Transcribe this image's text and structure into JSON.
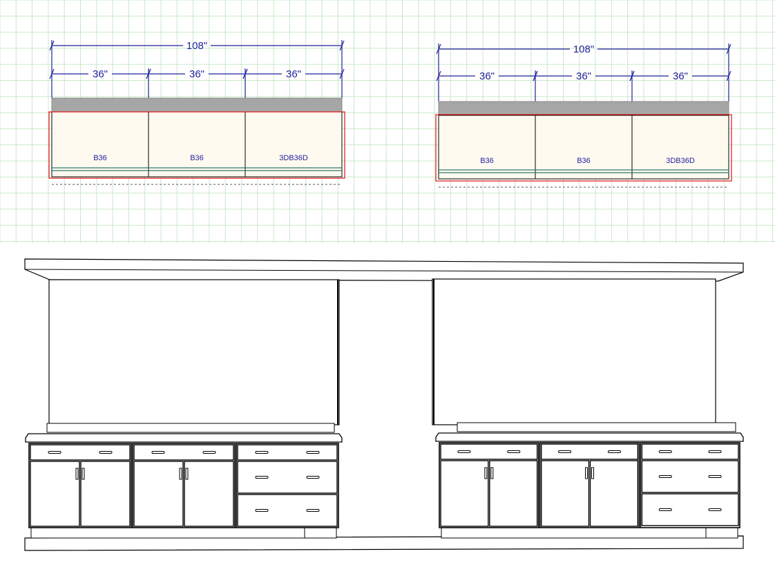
{
  "colors": {
    "grid": "#c9e8c9",
    "dimension": "#1f1f9c",
    "cabinet_fill": "#fffaf0",
    "countertop": "#a6a6a6",
    "outline_red": "#e01010",
    "toe_kick": "#2a7a6a",
    "line": "#000000"
  },
  "plan": {
    "runs": [
      {
        "overall_label": "108\"",
        "segment_labels": [
          "36\"",
          "36\"",
          "36\""
        ],
        "cabinets": [
          {
            "label": "B36",
            "type": "base"
          },
          {
            "label": "B36",
            "type": "base"
          },
          {
            "label": "3DB36D",
            "type": "drawer-base"
          }
        ]
      },
      {
        "overall_label": "108\"",
        "segment_labels": [
          "36\"",
          "36\"",
          "36\""
        ],
        "cabinets": [
          {
            "label": "B36",
            "type": "base"
          },
          {
            "label": "B36",
            "type": "base"
          },
          {
            "label": "3DB36D",
            "type": "drawer-base"
          }
        ]
      }
    ]
  },
  "elevation": {
    "runs": [
      {
        "cabinets": [
          "two-door-one-drawer",
          "two-door-one-drawer",
          "three-drawer"
        ]
      },
      {
        "cabinets": [
          "two-door-one-drawer",
          "two-door-one-drawer",
          "three-drawer"
        ]
      }
    ]
  }
}
